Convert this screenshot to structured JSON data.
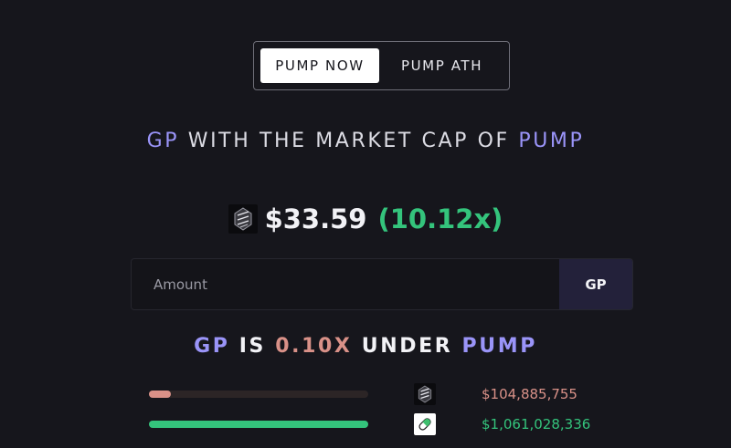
{
  "toggle": {
    "tab_now": "PUMP NOW",
    "tab_ath": "PUMP ATH"
  },
  "headline": {
    "token_a": "GP",
    "middle": "WITH THE MARKET CAP OF",
    "token_b": "PUMP"
  },
  "price": {
    "value": "$33.59",
    "multiplier": "(10.12x)",
    "icon": "gp-token-icon"
  },
  "amount": {
    "placeholder": "Amount",
    "unit_label": "GP"
  },
  "compare": {
    "token_a": "GP",
    "is": "IS",
    "ratio": "0.10X",
    "under": "UNDER",
    "token_b": "PUMP"
  },
  "bars": [
    {
      "icon": "gp-token-icon",
      "value": "$104,885,755",
      "fill_fraction": 0.1,
      "color": "#d99188"
    },
    {
      "icon": "pump-pill-icon",
      "value": "$1,061,028,336",
      "fill_fraction": 1.0,
      "color": "#34c47c"
    }
  ],
  "colors": {
    "accent": "#9a94f8",
    "green": "#34c47c",
    "salmon": "#d99188",
    "background": "#16161c"
  }
}
